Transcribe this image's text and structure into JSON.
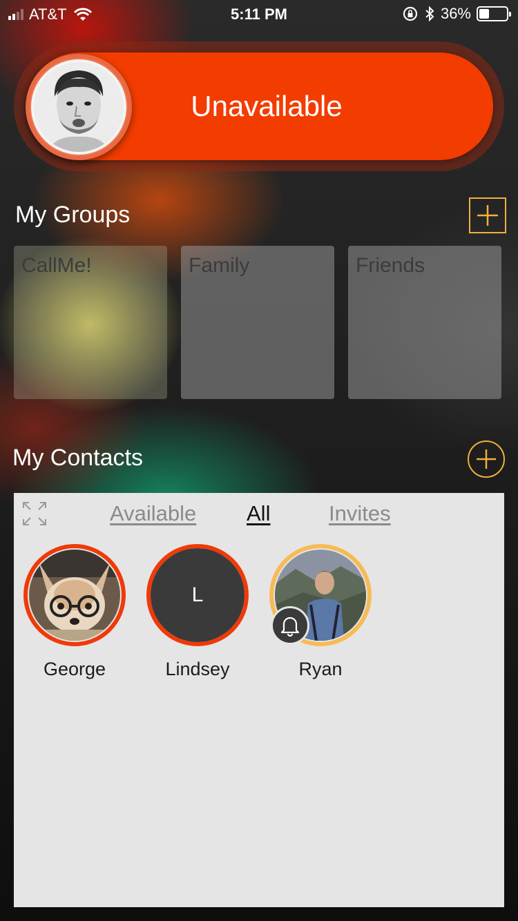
{
  "status_bar": {
    "carrier": "AT&T",
    "time": "5:11 PM",
    "battery": "36%",
    "battery_level": 0.36
  },
  "availability": {
    "label": "Unavailable",
    "color": "#f23c00"
  },
  "groups": {
    "title": "My Groups",
    "items": [
      {
        "label": "CallMe!"
      },
      {
        "label": "Family"
      },
      {
        "label": "Friends"
      }
    ]
  },
  "contacts": {
    "title": "My Contacts",
    "tabs": [
      {
        "label": "Available"
      },
      {
        "label": "All"
      },
      {
        "label": "Invites"
      }
    ],
    "active_tab": "All",
    "items": [
      {
        "name": "George",
        "initial": ""
      },
      {
        "name": "Lindsey",
        "initial": "L"
      },
      {
        "name": "Ryan",
        "initial": ""
      }
    ]
  },
  "colors": {
    "accent": "#f3b03c",
    "unavailable": "#ef3a08",
    "pending": "#f7bb55"
  }
}
